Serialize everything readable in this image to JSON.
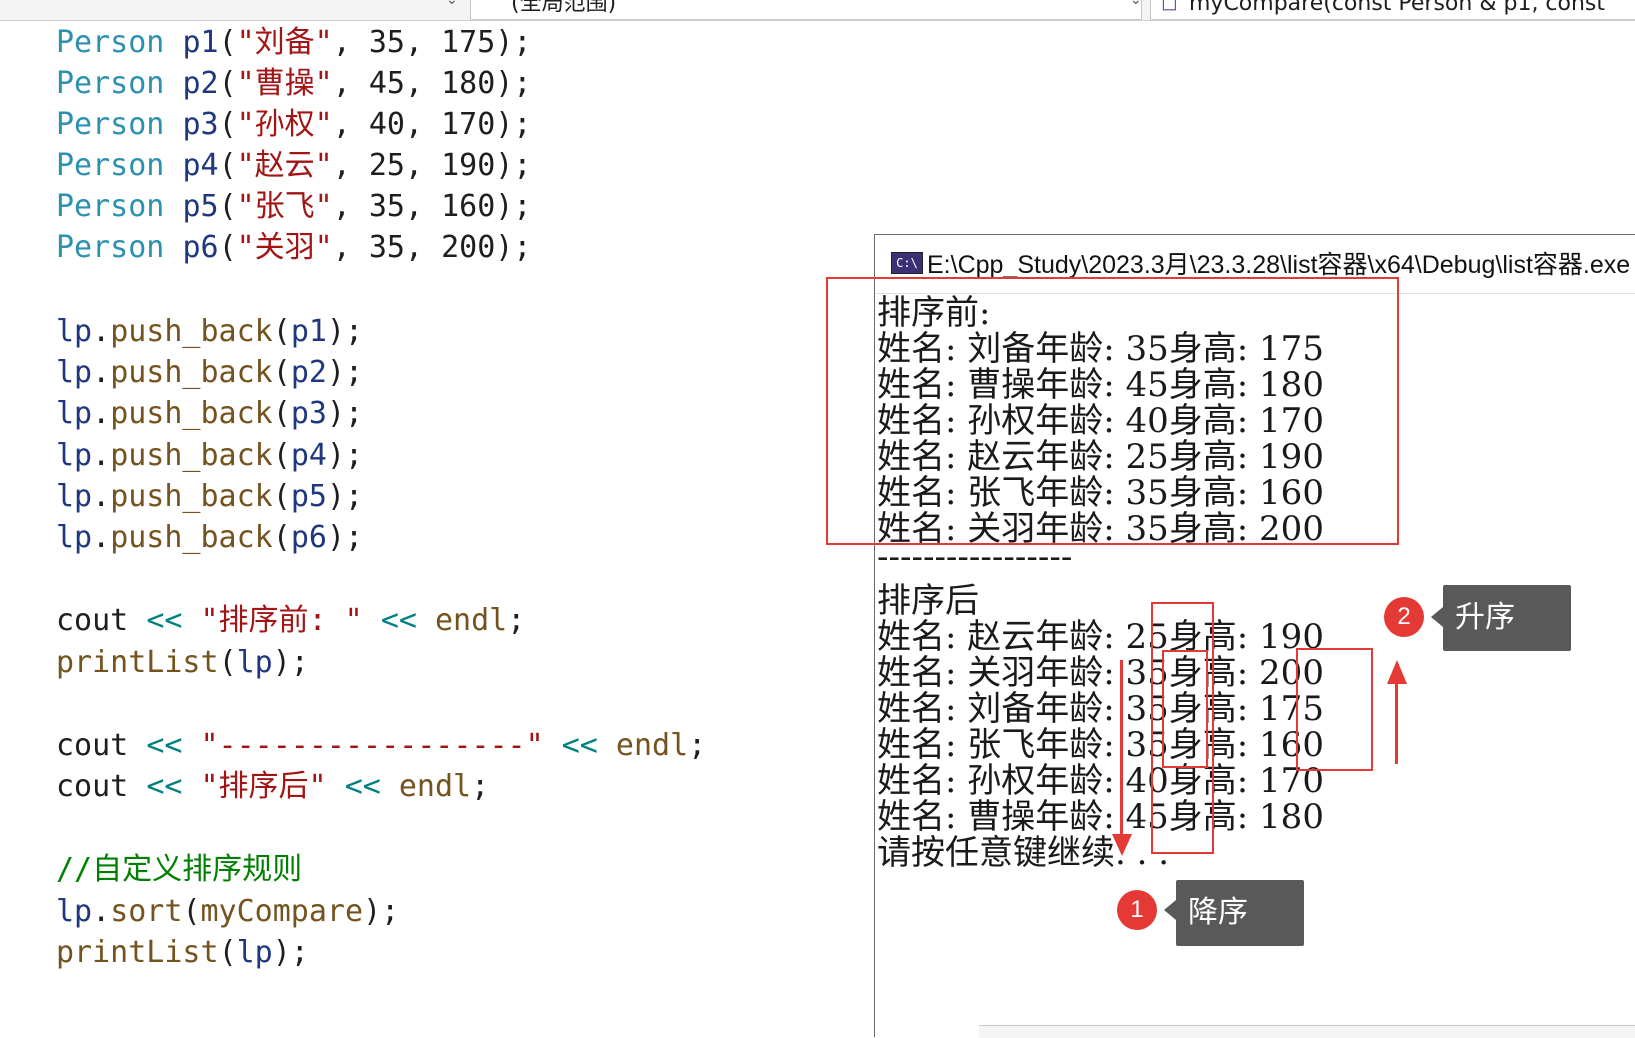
{
  "topbar": {
    "scope": "(全局范围)",
    "member": "myCompare(const Person & p1, const"
  },
  "code": {
    "persons": [
      {
        "type": "Person",
        "var": "p1",
        "name": "\"刘备\"",
        "args": ", 35, 175);"
      },
      {
        "type": "Person",
        "var": "p2",
        "name": "\"曹操\"",
        "args": ", 45, 180);"
      },
      {
        "type": "Person",
        "var": "p3",
        "name": "\"孙权\"",
        "args": ", 40, 170);"
      },
      {
        "type": "Person",
        "var": "p4",
        "name": "\"赵云\"",
        "args": ", 25, 190);"
      },
      {
        "type": "Person",
        "var": "p5",
        "name": "\"张飞\"",
        "args": ", 35, 160);"
      },
      {
        "type": "Person",
        "var": "p6",
        "name": "\"关羽\"",
        "args": ", 35, 200);"
      }
    ],
    "push_backs": [
      {
        "obj": "lp",
        "fn": "push_back",
        "arg": "p1"
      },
      {
        "obj": "lp",
        "fn": "push_back",
        "arg": "p2"
      },
      {
        "obj": "lp",
        "fn": "push_back",
        "arg": "p3"
      },
      {
        "obj": "lp",
        "fn": "push_back",
        "arg": "p4"
      },
      {
        "obj": "lp",
        "fn": "push_back",
        "arg": "p5"
      },
      {
        "obj": "lp",
        "fn": "push_back",
        "arg": "p6"
      }
    ],
    "cout1": {
      "kw": "cout",
      "op": "<<",
      "str": "\"排序前: \"",
      "endl": "endl"
    },
    "print1": {
      "fn": "printList",
      "arg": "lp"
    },
    "cout2": {
      "kw": "cout",
      "op": "<<",
      "str": "\"-----------------\"",
      "endl": "endl"
    },
    "cout3": {
      "kw": "cout",
      "op": "<<",
      "str": "\"排序后\"",
      "endl": "endl"
    },
    "comment": "//自定义排序规则",
    "sort": {
      "obj": "lp",
      "fn": "sort",
      "arg": "myCompare"
    },
    "print2": {
      "fn": "printList",
      "arg": "lp"
    }
  },
  "console": {
    "title": "E:\\Cpp_Study\\2023.3月\\23.3.28\\list容器\\x64\\Debug\\list容器.exe",
    "icon_label": "C:\\",
    "lines": [
      "排序前:",
      "姓名: 刘备年龄: 35身高: 175",
      "姓名: 曹操年龄: 45身高: 180",
      "姓名: 孙权年龄: 40身高: 170",
      "姓名: 赵云年龄: 25身高: 190",
      "姓名: 张飞年龄: 35身高: 160",
      "姓名: 关羽年龄: 35身高: 200",
      "-----------------",
      "排序后",
      "姓名: 赵云年龄: 25身高: 190",
      "姓名: 关羽年龄: 35身高: 200",
      "姓名: 刘备年龄: 35身高: 175",
      "姓名: 张飞年龄: 35身高: 160",
      "姓名: 孙权年龄: 40身高: 170",
      "姓名: 曹操年龄: 45身高: 180",
      "请按任意键继续. . ."
    ]
  },
  "annotations": {
    "badge1": "1",
    "label1": "降序",
    "badge2": "2",
    "label2": "升序",
    "accent_color": "#e53935",
    "callout_color": "#595959"
  }
}
